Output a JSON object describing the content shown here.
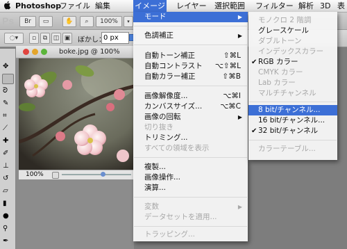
{
  "menubar": {
    "app_name": "Photoshop",
    "items": [
      "ファイル",
      "編集",
      "イメージ",
      "レイヤー",
      "選択範囲",
      "フィルター",
      "解析",
      "3D",
      "表"
    ]
  },
  "options": {
    "feather_label": "ぼかし：",
    "feather_value": "0 px",
    "zoom_label": "100%"
  },
  "document": {
    "title": "boke.jpg @ 100%",
    "zoom": "100%"
  },
  "image_menu": {
    "items": [
      {
        "label": "モード",
        "submenu": true,
        "highlighted": true
      },
      {
        "label": "色調補正",
        "submenu": true
      },
      {
        "label": "自動トーン補正",
        "shortcut": "⇧⌘L"
      },
      {
        "label": "自動コントラスト",
        "shortcut": "⌥⇧⌘L"
      },
      {
        "label": "自動カラー補正",
        "shortcut": "⇧⌘B"
      },
      {
        "label": "画像解像度...",
        "shortcut": "⌥⌘I"
      },
      {
        "label": "カンバスサイズ...",
        "shortcut": "⌥⌘C"
      },
      {
        "label": "画像の回転",
        "submenu": true
      },
      {
        "label": "切り抜き",
        "disabled": true
      },
      {
        "label": "トリミング..."
      },
      {
        "label": "すべての領域を表示",
        "disabled": true
      },
      {
        "label": "複製..."
      },
      {
        "label": "画像操作..."
      },
      {
        "label": "演算..."
      },
      {
        "label": "変数",
        "disabled": true,
        "submenu": true
      },
      {
        "label": "データセットを適用...",
        "disabled": true
      },
      {
        "label": "トラッピング...",
        "disabled": true
      }
    ]
  },
  "mode_submenu": {
    "items": [
      {
        "label": "モノクロ 2 階調",
        "disabled": true
      },
      {
        "label": "グレースケール"
      },
      {
        "label": "ダブルトーン",
        "disabled": true
      },
      {
        "label": "インデックスカラー",
        "disabled": true
      },
      {
        "label": "RGB カラー",
        "checked": true
      },
      {
        "label": "CMYK カラー",
        "disabled": true
      },
      {
        "label": "Lab カラー",
        "disabled": true
      },
      {
        "label": "マルチチャンネル",
        "disabled": true
      },
      {
        "label": "8 bit/チャンネル...",
        "highlighted": true
      },
      {
        "label": "16 bit/チャンネル..."
      },
      {
        "label": "32 bit/チャンネル",
        "checked": true
      },
      {
        "label": "カラーテーブル...",
        "disabled": true
      }
    ]
  },
  "colors": {
    "highlight": "#3c6fd6"
  }
}
